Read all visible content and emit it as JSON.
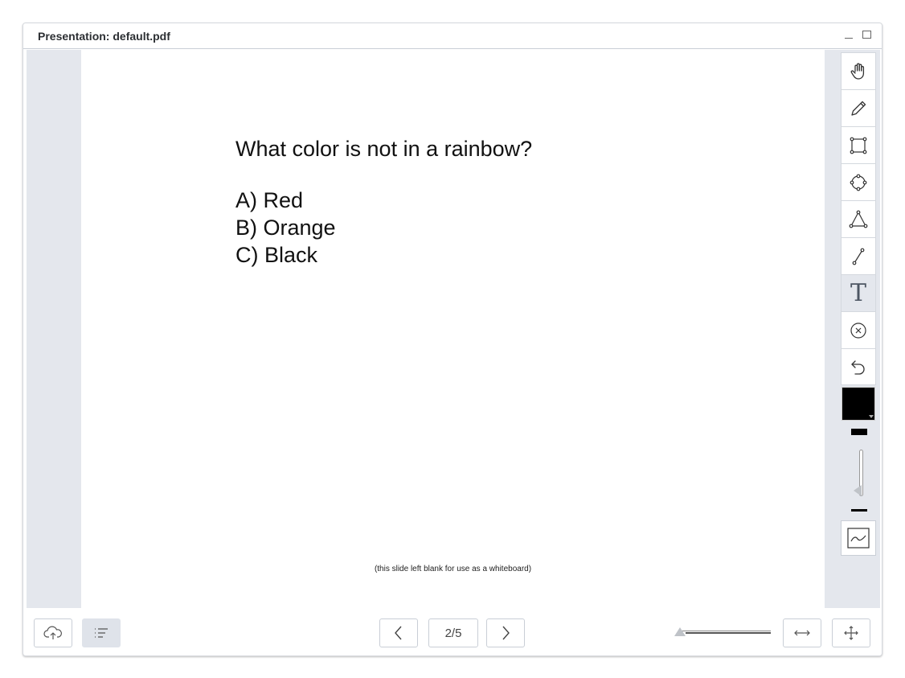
{
  "window": {
    "title": "Presentation: default.pdf"
  },
  "slide": {
    "question": "What color is not in a rainbow?",
    "answers": [
      "A) Red",
      "B) Orange",
      "C) Black"
    ],
    "note": "(this slide left blank for use as a whiteboard)"
  },
  "toolbar": {
    "tools": [
      {
        "name": "pan",
        "icon": "hand-icon"
      },
      {
        "name": "pencil",
        "icon": "pencil-icon"
      },
      {
        "name": "rectangle",
        "icon": "rectangle-icon"
      },
      {
        "name": "ellipse",
        "icon": "ellipse-icon"
      },
      {
        "name": "triangle",
        "icon": "triangle-icon"
      },
      {
        "name": "line",
        "icon": "line-icon"
      },
      {
        "name": "text",
        "icon": "text-icon",
        "label": "T",
        "active": true
      },
      {
        "name": "clear",
        "icon": "clear-icon"
      },
      {
        "name": "undo",
        "icon": "undo-icon"
      }
    ],
    "current_color": "#000000"
  },
  "bottombar": {
    "page": "2/5",
    "upload_icon": "cloud-upload-icon",
    "thumbnails_icon": "list-icon",
    "prev_icon": "chevron-left-icon",
    "next_icon": "chevron-right-icon",
    "fit_width_icon": "fit-width-icon",
    "fit_page_icon": "fit-page-icon"
  }
}
